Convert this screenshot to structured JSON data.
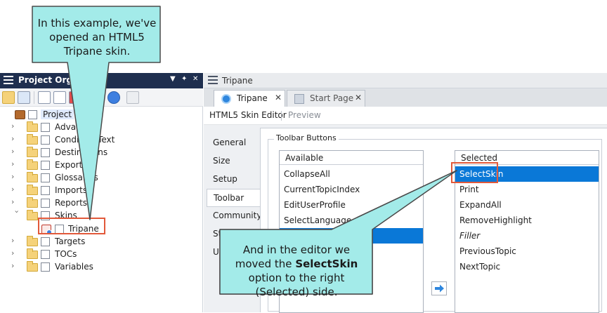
{
  "project_organizer": {
    "title": "Project Organizer",
    "tree": [
      {
        "label": "Project",
        "kind": "root"
      },
      {
        "label": "Advanced",
        "kind": "folder",
        "expanded": false
      },
      {
        "label": "Condition Text",
        "kind": "folder",
        "expanded": false
      },
      {
        "label": "Destinations",
        "kind": "folder",
        "expanded": false
      },
      {
        "label": "Exports",
        "kind": "folder",
        "expanded": false
      },
      {
        "label": "Glossaries",
        "kind": "folder",
        "expanded": false
      },
      {
        "label": "Imports",
        "kind": "folder",
        "expanded": false
      },
      {
        "label": "Reports",
        "kind": "folder",
        "expanded": false
      },
      {
        "label": "Skins",
        "kind": "folder",
        "expanded": true
      },
      {
        "label": "Tripane",
        "kind": "skin"
      },
      {
        "label": "Targets",
        "kind": "folder",
        "expanded": false
      },
      {
        "label": "TOCs",
        "kind": "folder",
        "expanded": false
      },
      {
        "label": "Variables",
        "kind": "folder",
        "expanded": false
      }
    ]
  },
  "editor": {
    "window_title": "Tripane",
    "tabs": [
      {
        "label": "Tripane",
        "active": true
      },
      {
        "label": "Start Page",
        "active": false
      }
    ],
    "subtabs": {
      "skin_editor": "HTML5 Skin Editor",
      "preview": "Preview"
    },
    "side_tabs": [
      "General",
      "Size",
      "Setup",
      "Toolbar",
      "Community",
      "Styles",
      "UI Text"
    ],
    "selected_side_tab": "Toolbar",
    "group_label": "Toolbar Buttons",
    "available": {
      "header": "Available",
      "items": [
        "CollapseAll",
        "CurrentTopicIndex",
        "EditUserProfile",
        "SelectLanguage",
        ""
      ],
      "selected_index": 4
    },
    "selected": {
      "header": "Selected",
      "items": [
        "SelectSkin",
        "Print",
        "ExpandAll",
        "RemoveHighlight",
        "Filler",
        "PreviousTopic",
        "NextTopic"
      ],
      "selected_index": 0,
      "italic_index": 4
    }
  },
  "callouts": {
    "top": {
      "text": "In this example, we've opened an HTML5 Tripane skin."
    },
    "bottom": {
      "text_before": "And in the editor we moved the ",
      "text_bold": "SelectSkin",
      "text_after": " option to the right (Selected) side."
    }
  },
  "colors": {
    "callout_fill": "#a3ebe9",
    "callout_border": "#4a4a4a",
    "highlight_border": "#e2593a",
    "selection": "#0a78d7",
    "title_bar": "#1f2f4f"
  }
}
